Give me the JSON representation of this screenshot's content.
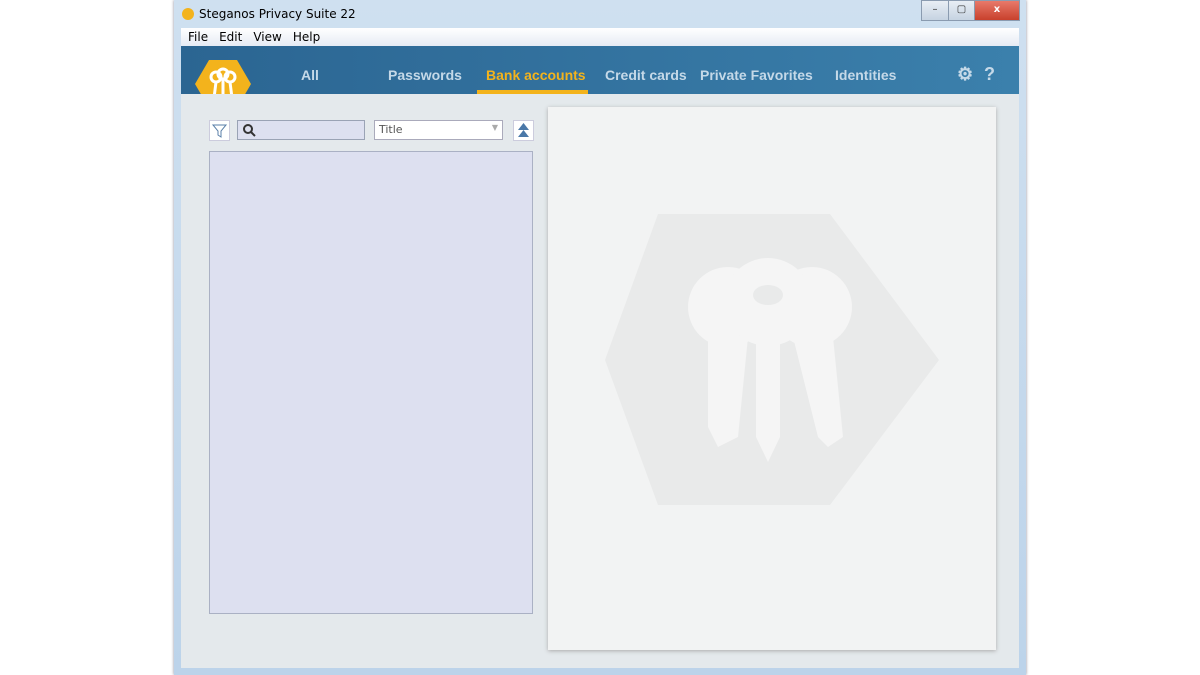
{
  "window": {
    "title": "Steganos Privacy Suite 22",
    "minimize": "–",
    "maximize": "▢",
    "close": "x"
  },
  "menu": [
    "File",
    "Edit",
    "View",
    "Help"
  ],
  "nav": {
    "tabs": [
      {
        "label": "All"
      },
      {
        "label": "Passwords"
      },
      {
        "label": "Bank accounts",
        "active": true
      },
      {
        "label": "Credit cards"
      },
      {
        "label": "Private Favorites"
      },
      {
        "label": "Identities"
      }
    ],
    "settings_icon": "gear-icon",
    "help": "?"
  },
  "toolbar": {
    "search_value": "",
    "sort_field": "Title"
  },
  "colors": {
    "accent": "#f3b31c",
    "nav": "#2f6f9c"
  }
}
